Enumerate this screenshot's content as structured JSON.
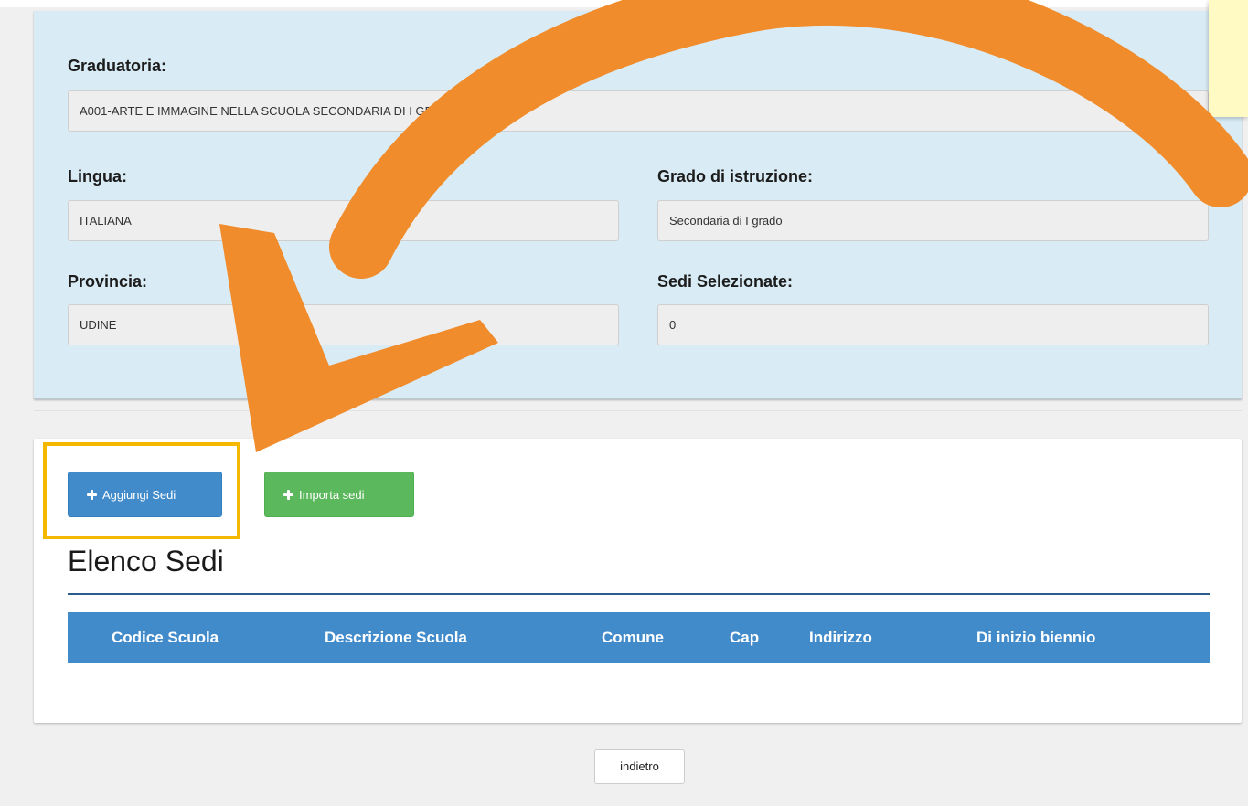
{
  "form": {
    "graduatoria_label": "Graduatoria:",
    "graduatoria_value": "A001-ARTE E IMMAGINE NELLA SCUOLA SECONDARIA DI I GRADO",
    "lingua_label": "Lingua:",
    "lingua_value": "ITALIANA",
    "grado_label": "Grado di istruzione:",
    "grado_value": "Secondaria di I grado",
    "provincia_label": "Provincia:",
    "provincia_value": "UDINE",
    "sedi_label": "Sedi Selezionate:",
    "sedi_value": "0"
  },
  "actions": {
    "add_label": "Aggiungi Sedi",
    "import_label": "Importa sedi",
    "back_label": "indietro"
  },
  "list": {
    "title": "Elenco Sedi",
    "columns": [
      "Codice Scuola",
      "Descrizione Scuola",
      "Comune",
      "Cap",
      "Indirizzo",
      "Di inizio biennio"
    ]
  },
  "colors": {
    "arrow": "#f08c2b",
    "highlight": "#f5b800",
    "primary": "#428bca",
    "success": "#5cb85c",
    "panel": "#d9ebf5"
  },
  "icons": [
    "plus-icon",
    "curved-arrow-annotation"
  ]
}
